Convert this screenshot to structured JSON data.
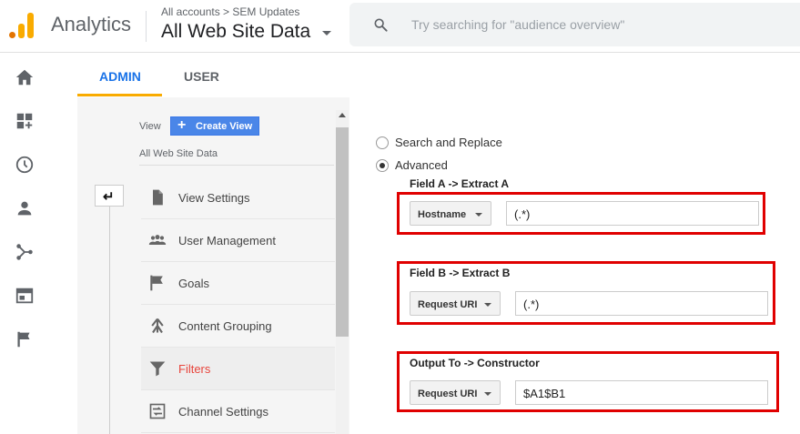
{
  "header": {
    "app_title": "Analytics",
    "breadcrumb": "All accounts > SEM Updates",
    "view_name": "All Web Site Data",
    "search_placeholder": "Try searching for \"audience overview\""
  },
  "tabs": [
    {
      "label": "ADMIN",
      "active": true
    },
    {
      "label": "USER",
      "active": false
    }
  ],
  "view_column": {
    "label": "View",
    "create_button": "Create View",
    "current_view": "All Web Site Data",
    "items": [
      {
        "label": "View Settings",
        "icon": "document-icon"
      },
      {
        "label": "User Management",
        "icon": "users-icon"
      },
      {
        "label": "Goals",
        "icon": "flag-icon"
      },
      {
        "label": "Content Grouping",
        "icon": "grouping-icon"
      },
      {
        "label": "Filters",
        "icon": "filter-icon",
        "active": true
      },
      {
        "label": "Channel Settings",
        "icon": "channel-settings-icon"
      }
    ]
  },
  "filter_form": {
    "options": [
      {
        "label": "Search and Replace",
        "checked": false
      },
      {
        "label": "Advanced",
        "checked": true
      }
    ],
    "field_a": {
      "title": "Field A -> Extract A",
      "select": "Hostname",
      "value": "(.*)"
    },
    "field_b": {
      "title": "Field B -> Extract B",
      "select": "Request URI",
      "value": "(.*)"
    },
    "output": {
      "title": "Output To -> Constructor",
      "select": "Request URI",
      "value": "$A1$B1"
    }
  },
  "colors": {
    "accent_blue": "#1a73e8",
    "active_red": "#e8453c",
    "highlight_red": "#e00000",
    "tab_underline": "#f9ab00"
  }
}
